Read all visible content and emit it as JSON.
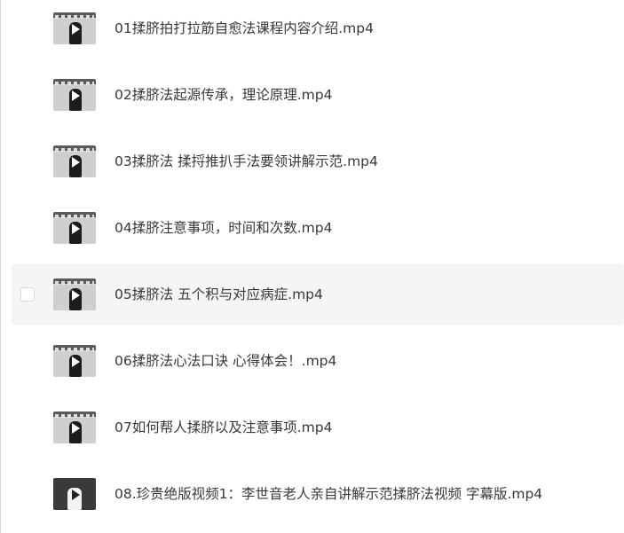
{
  "files": [
    {
      "name": "01揉脐拍打拉筋自愈法课程内容介绍.mp4"
    },
    {
      "name": "02揉脐法起源传承，理论原理.mp4"
    },
    {
      "name": "03揉脐法 揉捋推扒手法要领讲解示范.mp4"
    },
    {
      "name": "04揉脐注意事项，时间和次数.mp4"
    },
    {
      "name": "05揉脐法 五个积与对应病症.mp4"
    },
    {
      "name": "06揉脐法心法口诀 心得体会！.mp4"
    },
    {
      "name": "07如何帮人揉脐以及注意事项.mp4"
    },
    {
      "name": "08.珍贵绝版视频1：李世音老人亲自讲解示范揉脐法视频  字幕版.mp4"
    }
  ],
  "colors": {
    "hover_row": "#f5f5f6",
    "text": "#37393d"
  },
  "icons": {
    "thumbnail": "video-thumbnail-icon",
    "play": "play-icon"
  }
}
